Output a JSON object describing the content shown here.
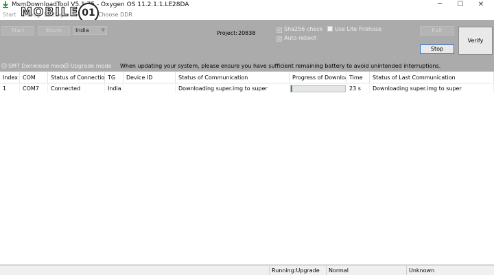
{
  "window": {
    "title": "MsmDownloadTool V5.1.75 - Oxygen OS 11.2.1.1.LE28DA",
    "minimize_glyph": "─",
    "maximize_glyph": "☐",
    "close_glyph": "✕"
  },
  "watermark": {
    "text": "MOBILE",
    "circle_text": "01"
  },
  "menu": {
    "items": [
      "Start",
      "Debug",
      "Setting"
    ],
    "choose_ddr": "Choose DDR"
  },
  "toolbar": {
    "start_label": "Start",
    "enum_label": "Enum",
    "region_value": "India",
    "project_label": "Project:",
    "project_value": "20838",
    "sha256_label": "Sha256 check",
    "sha256_checked": true,
    "lite_firehose_label": "Use Lite Firehose",
    "lite_firehose_checked": false,
    "auto_reboot_label": "Auto reboot",
    "auto_reboot_checked": true,
    "exit_label": "Exit",
    "stop_label": "Stop",
    "verify_label": "Verify",
    "smt_label": "SMT Donwload mode",
    "upgrade_label": "Upgrade mode",
    "warning": "When updating your system, please ensure you have sufficient remaining battery to avoid unintended interruptions."
  },
  "table": {
    "headers": [
      "Index",
      "COM",
      "Status of Connection",
      "TG",
      "Device ID",
      "Status of Communication",
      "Progress of Download",
      "Time",
      "Status of Last Communication"
    ],
    "rows": [
      {
        "index": "1",
        "com": "COM7",
        "connection": "Connected",
        "tg": "India",
        "device_id": "",
        "communication": "Downloading super.img to super",
        "progress": 0.02,
        "time": "23 s",
        "last_communication": "Downloading super.img to super"
      }
    ]
  },
  "status": {
    "mode": "Running:Upgrade",
    "state": "Normal",
    "extra": "Unknown"
  },
  "colors": {
    "panel_bg": "#ababab",
    "progress_green": "#06b025",
    "focus_blue": "#2b6fcf"
  }
}
